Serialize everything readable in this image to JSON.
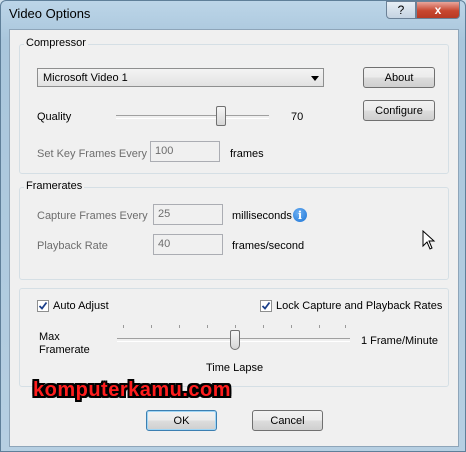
{
  "window": {
    "title": "Video Options",
    "help_label": "?",
    "close_label": "x"
  },
  "compressor": {
    "legend": "Compressor",
    "codec": "Microsoft Video 1",
    "about_label": "About",
    "configure_label": "Configure",
    "quality_label": "Quality",
    "quality_value": "70",
    "quality_fraction": 0.7,
    "keyframes_label": "Set Key Frames Every",
    "keyframes_value": "100",
    "keyframes_unit": "frames"
  },
  "framerates": {
    "legend": "Framerates",
    "capture_label": "Capture Frames Every",
    "capture_value": "25",
    "capture_unit": "milliseconds",
    "info_icon": "info-icon",
    "playback_label": "Playback Rate",
    "playback_value": "40",
    "playback_unit": "frames/second"
  },
  "options": {
    "auto_adjust_label": "Auto Adjust",
    "auto_adjust_checked": true,
    "lock_label": "Lock Capture and Playback Rates",
    "lock_checked": true,
    "max_framerate_line1": "Max",
    "max_framerate_line2": "Framerate",
    "slider_right_label": "1 Frame/Minute",
    "slider_bottom_label": "Time Lapse"
  },
  "watermark": "komputerkamu.com",
  "footer": {
    "ok_label": "OK",
    "cancel_label": "Cancel"
  },
  "colors": {
    "watermark": "#ff1d1d",
    "info_icon": "#1a73d6",
    "default_button_border": "#3c7fb1"
  }
}
